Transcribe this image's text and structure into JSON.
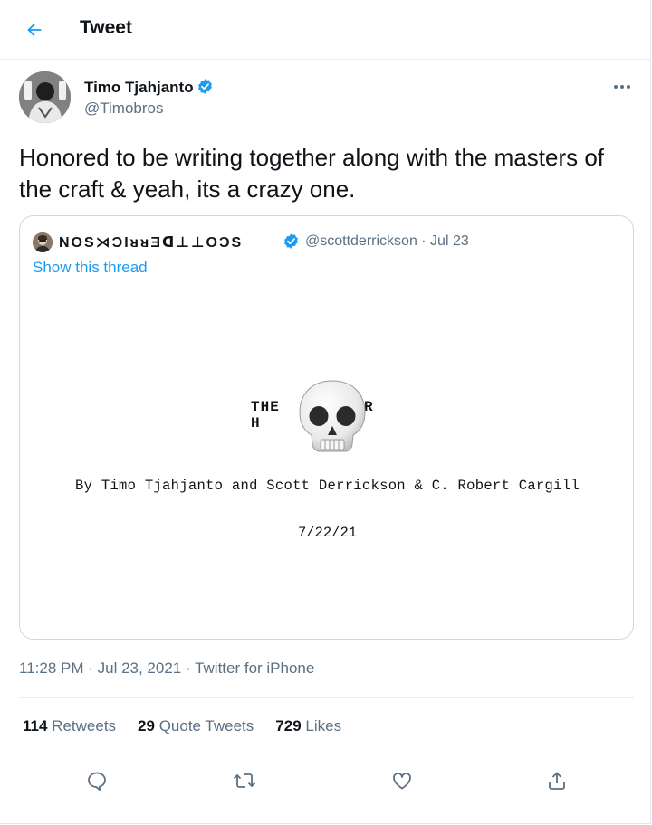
{
  "header": {
    "title": "Tweet",
    "back_icon": "arrow-left-icon",
    "accent_color": "#1d9bf0"
  },
  "tweet": {
    "author_name": "Timo Tjahjanto",
    "author_handle": "@Timobros",
    "verified": true,
    "text": "Honored to be writing together along with the masters of the craft & yeah, its a crazy one.",
    "timestamp": "11:28 PM · Jul 23, 2021",
    "source": "Twitter for iPhone",
    "stats": {
      "retweets_count": "114",
      "retweets_label": "Retweets",
      "quotes_count": "29",
      "quotes_label": "Quote Tweets",
      "likes_count": "729",
      "likes_label": "Likes"
    }
  },
  "quoted_tweet": {
    "author_name": "NOS⋊ƆIᴚᴚƎᗡ⊥⊥OƆS",
    "meta": "@scottderrickson · Jul 23",
    "verified": true,
    "show_thread": "Show this thread",
    "media": {
      "title_start": "THE H",
      "title_end": "R",
      "byline": "By Timo Tjahjanto and Scott Derrickson & C. Robert Cargill",
      "date": "7/22/21",
      "emoji": "skull-emoji"
    }
  },
  "actions": [
    "reply-icon",
    "retweet-icon",
    "like-icon",
    "share-icon"
  ],
  "colors": {
    "text": "#0f1419",
    "secondary": "#5b7083",
    "border": "#cfd9de",
    "verified": "#1d9bf0"
  }
}
